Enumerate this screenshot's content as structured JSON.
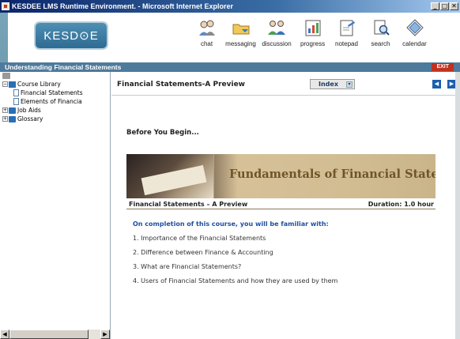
{
  "window": {
    "title": "KESDEE LMS Runtime Environment. - Microsoft Internet Explorer",
    "min_label": "_",
    "max_label": "□",
    "close_label": "✕"
  },
  "brand": {
    "logo_text": "KESD⊙E"
  },
  "toolbar": [
    {
      "label": "chat",
      "icon": "chat-icon"
    },
    {
      "label": "messaging",
      "icon": "messaging-icon"
    },
    {
      "label": "discussion",
      "icon": "discussion-icon"
    },
    {
      "label": "progress",
      "icon": "progress-icon"
    },
    {
      "label": "notepad",
      "icon": "notepad-icon"
    },
    {
      "label": "search",
      "icon": "search-icon"
    },
    {
      "label": "calendar",
      "icon": "calendar-icon"
    }
  ],
  "course_bar": {
    "title": "Understanding Financial Statements",
    "exit_label": "EXIT"
  },
  "tree": {
    "root": {
      "label": "Course Library"
    },
    "items": [
      {
        "label": "Financial Statements",
        "level": 2
      },
      {
        "label": "Elements of Financia",
        "level": 2
      },
      {
        "label": "Job Aids",
        "level": 1
      },
      {
        "label": "Glossary",
        "level": 1
      }
    ]
  },
  "main": {
    "slide_title": "Financial Statements-A Preview",
    "index_label": "Index",
    "index_arrow": "▾",
    "prev_label": "◀",
    "next_label": "▶",
    "intro": "Before You Begin...",
    "banner_title": "Fundamentals of Financial Statements",
    "course_name": "Financial Statements – A Preview",
    "duration": "Duration: 1.0 hour",
    "completion": "On completion of this course, you will be familiar with:",
    "objectives": [
      "1.  Importance of the Financial Statements",
      "2.  Difference between Finance & Accounting",
      "3.  What are Financial Statements?",
      "4.  Users of Financial Statements and how they are used by them"
    ]
  },
  "scroll": {
    "left_arrow": "◀",
    "right_arrow": "▶"
  },
  "colors": {
    "accent": "#4e7a9c",
    "exit": "#c0311f",
    "link_blue": "#1f4fa0",
    "nav_blue": "#1b5fb0"
  }
}
